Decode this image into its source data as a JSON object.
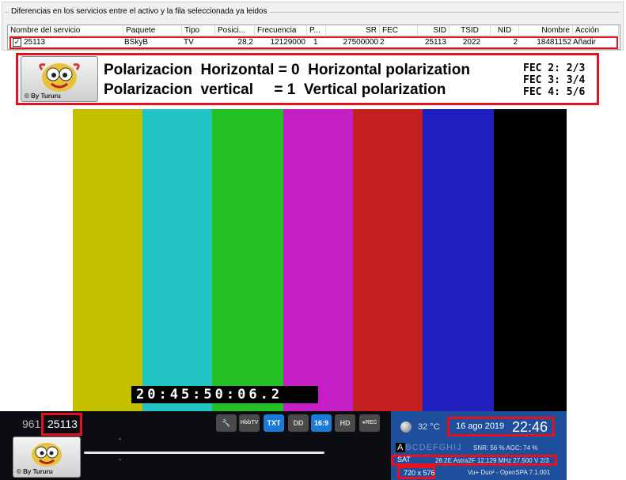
{
  "panel": {
    "title": "Diferencias en los servicios entre el activo y la fila seleccionada ya leidos",
    "columns": [
      "Nombre del servicio",
      "Paquete",
      "Tipo",
      "Posici...",
      "Frecuencia",
      "P...",
      "SR",
      "FEC",
      "SID",
      "TSID",
      "NID",
      "Nombre",
      "Acción"
    ],
    "row": {
      "checked": "✓",
      "service": "25113",
      "package": "BSkyB",
      "type": "TV",
      "position": "28,2",
      "frequency": "12129000",
      "pol": "1",
      "sr": "27500000",
      "fec": "2",
      "sid": "25113",
      "tsid": "2022",
      "nid": "2",
      "name": "18481152",
      "action": "Añadir"
    }
  },
  "legend": {
    "logo_text": "© By Tururu",
    "line1": "Polarizacion  Horizontal = 0  Horizontal polarization",
    "line2": "Polarizacion  vertical     = 1  Vertical polarization",
    "fec": [
      "FEC 2: 2/3",
      "FEC 3: 3/4",
      "FEC 4: 5/6"
    ]
  },
  "tv": {
    "bar_colors": [
      "#ffffff",
      "#c4c000",
      "#22c4c4",
      "#22c022",
      "#c41fc4",
      "#c41e1e",
      "#1f1fbf",
      "#000000"
    ],
    "timecode": "20:45:50:06.2"
  },
  "infobar": {
    "channel_number": "961",
    "service_name": "25113",
    "logo_text": "© By Tururu",
    "dash": "-",
    "icons": [
      {
        "name": "wrench-icon",
        "label": "🔧",
        "active": false
      },
      {
        "name": "hbbtv-icon",
        "label": "HbbTV",
        "active": false
      },
      {
        "name": "teletext-icon",
        "label": "TXT",
        "active": true
      },
      {
        "name": "dolby-icon",
        "label": "DD",
        "active": false
      },
      {
        "name": "widescreen-icon",
        "label": "16:9",
        "active": true
      },
      {
        "name": "hd-icon",
        "label": "HD",
        "active": false
      },
      {
        "name": "rec-icon",
        "label": "●REC",
        "active": false
      }
    ]
  },
  "info": {
    "temperature": "32 °C",
    "date": "16 ago 2019",
    "time": "22:46",
    "caids_first": "A",
    "caids_rest": "BCDEFGHIJ",
    "signal": "SNR: 56 %     AGC: 74 %",
    "sat_label": "SAT",
    "sat_info": "28.2E Astra2F 12.129 MHz 27.500 V 2/3",
    "resolution": "720 x 576",
    "box": "Vu+ Duo² - OpenSPA 7.1.001"
  }
}
